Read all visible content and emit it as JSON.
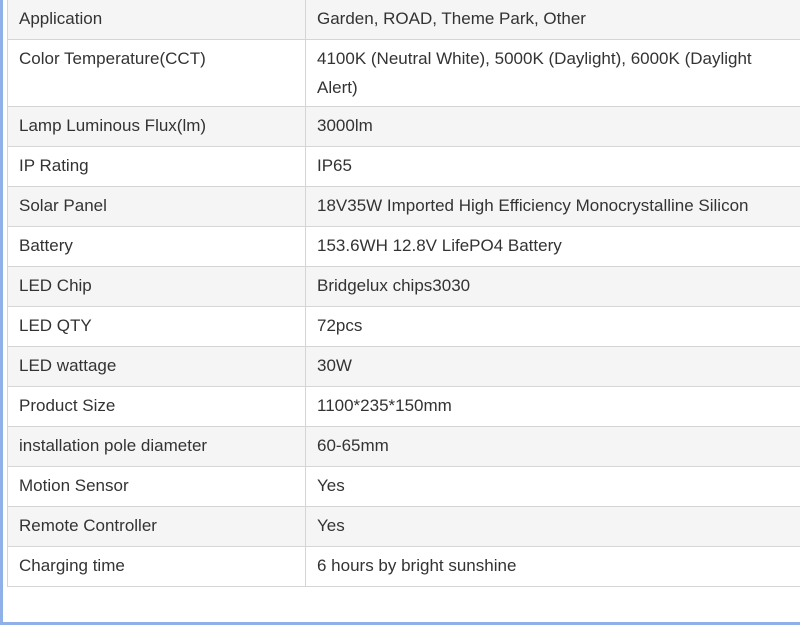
{
  "spec_table": {
    "rows": [
      {
        "label": "Application",
        "value": "Garden, ROAD, Theme Park, Other"
      },
      {
        "label": "Color Temperature(CCT)",
        "value": "4100K (Neutral White), 5000K (Daylight), 6000K (Daylight Alert)"
      },
      {
        "label": "Lamp Luminous Flux(lm)",
        "value": "3000lm"
      },
      {
        "label": "IP Rating",
        "value": "IP65"
      },
      {
        "label": "Solar Panel",
        "value": "18V35W Imported High Efficiency Monocrystalline Silicon"
      },
      {
        "label": "Battery",
        "value": "153.6WH 12.8V LifePO4 Battery"
      },
      {
        "label": "LED Chip",
        "value": "Bridgelux chips3030"
      },
      {
        "label": "LED QTY",
        "value": "72pcs"
      },
      {
        "label": "LED wattage",
        "value": "30W"
      },
      {
        "label": "Product Size",
        "value": "1100*235*150mm"
      },
      {
        "label": "installation pole diameter",
        "value": "60-65mm"
      },
      {
        "label": "Motion Sensor",
        "value": "Yes"
      },
      {
        "label": "Remote Controller",
        "value": "Yes"
      },
      {
        "label": "Charging time",
        "value": "6 hours by bright sunshine"
      }
    ]
  }
}
